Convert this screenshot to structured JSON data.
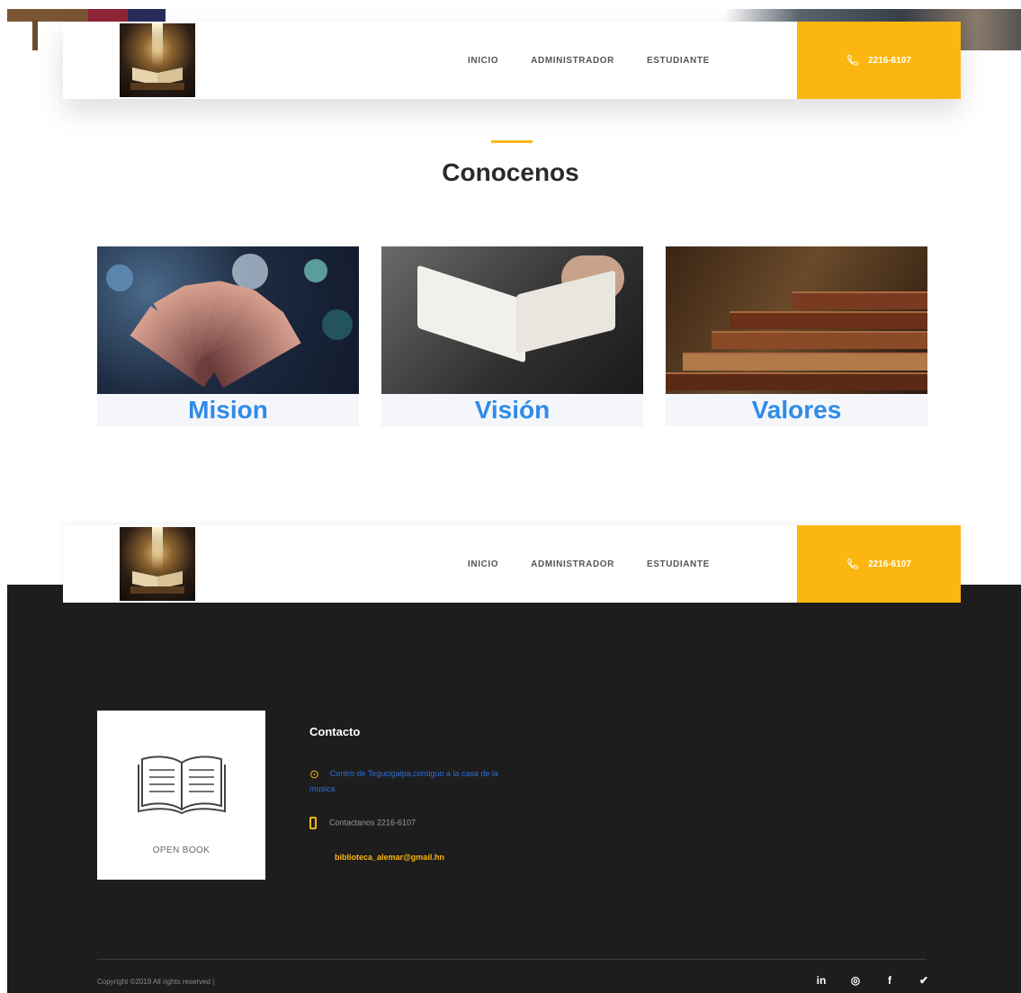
{
  "nav": {
    "links": [
      "INICIO",
      "ADMINISTRADOR",
      "ESTUDIANTE"
    ],
    "phone": "2216-6107"
  },
  "section": {
    "title": "Conocenos"
  },
  "cards": [
    {
      "caption": "Mision"
    },
    {
      "caption": "Visión"
    },
    {
      "caption": "Valores"
    }
  ],
  "footer": {
    "logo_text": "OPEN BOOK",
    "contact_title": "Contacto",
    "address": "Centro de Tegucigalpa,contiguo a la casa de la musica",
    "phone_text": "Contactanos 2216-6107",
    "email": "biblioteca_alemar@gmail.hn",
    "copyright": "Copyright ©2019 All rights reserved |",
    "socials": [
      "in",
      "◎",
      "f",
      "✔"
    ]
  },
  "colors": {
    "accent": "#fbb710",
    "link_blue": "#2f8be8",
    "footer_bg": "#1d1d1d"
  }
}
